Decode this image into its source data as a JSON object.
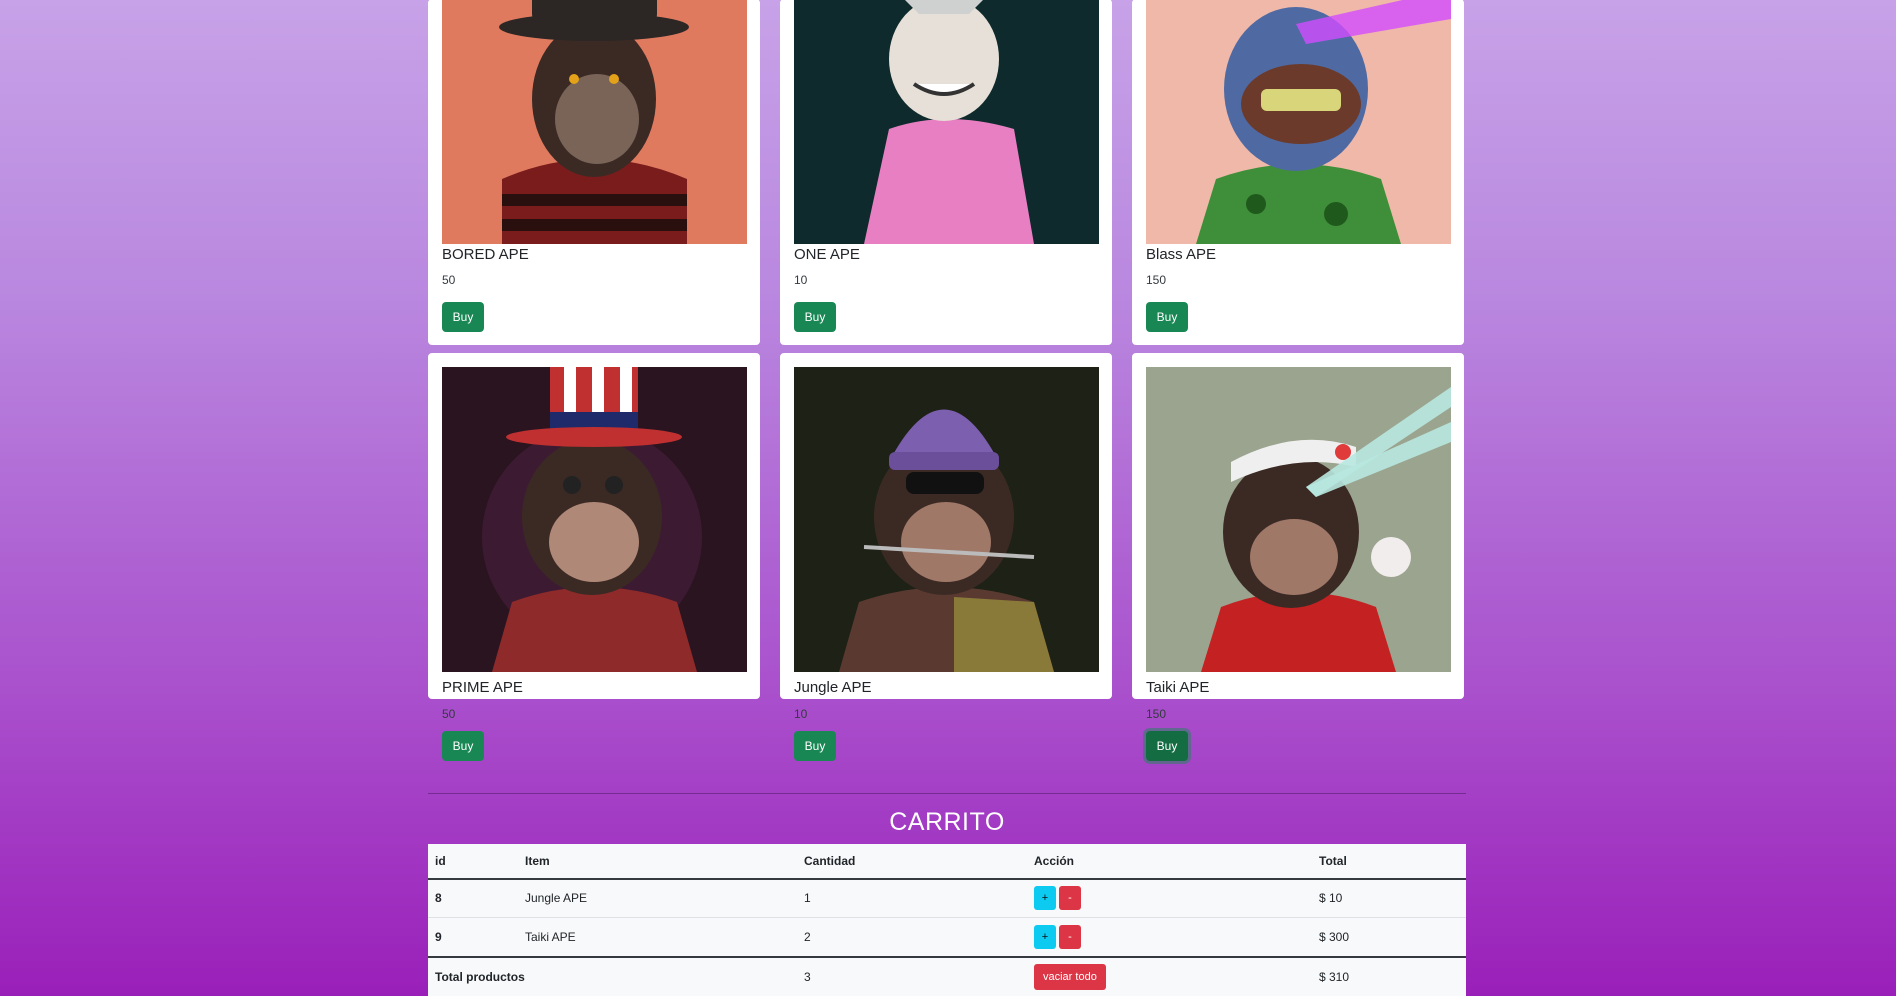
{
  "products": [
    {
      "name": "BORED APE",
      "price": "50",
      "buy_label": "Buy",
      "bg": "#e07a5f"
    },
    {
      "name": "ONE APE",
      "price": "10",
      "buy_label": "Buy",
      "bg": "#0f2a2c"
    },
    {
      "name": "Blass APE",
      "price": "150",
      "buy_label": "Buy",
      "bg": "#efb8a8"
    },
    {
      "name": "PRIME APE",
      "price": "50",
      "buy_label": "Buy",
      "bg": "#2a1420"
    },
    {
      "name": "Jungle APE",
      "price": "10",
      "buy_label": "Buy",
      "bg": "#1d2116"
    },
    {
      "name": "Taiki APE",
      "price": "150",
      "buy_label": "Buy",
      "bg": "#9ba48f"
    }
  ],
  "cart": {
    "title": "CARRITO",
    "headers": {
      "id": "id",
      "item": "Item",
      "qty": "Cantidad",
      "action": "Acción",
      "total": "Total"
    },
    "rows": [
      {
        "id": "8",
        "item": "Jungle APE",
        "qty": "1",
        "plus": "+",
        "minus": "-",
        "total": "$ 10"
      },
      {
        "id": "9",
        "item": "Taiki APE",
        "qty": "2",
        "plus": "+",
        "minus": "-",
        "total": "$ 300"
      }
    ],
    "footer": {
      "label": "Total productos",
      "qty": "3",
      "clear_label": "vaciar todo",
      "total": "$ 310"
    }
  }
}
